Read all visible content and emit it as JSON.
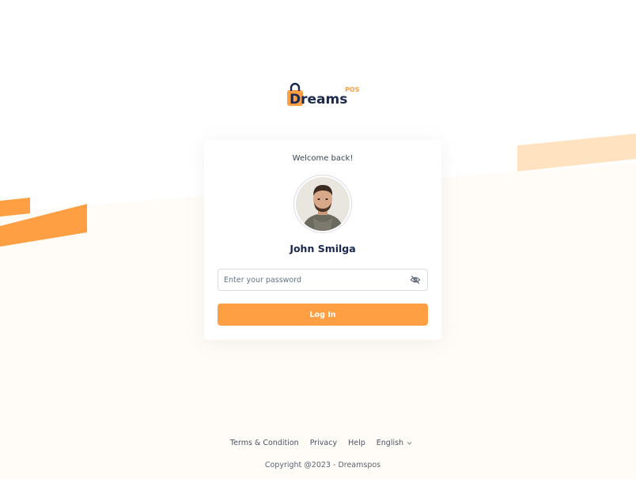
{
  "brand": {
    "logo_text": "Dreams",
    "logo_suffix": "POS",
    "accent_color": "#fe9f43",
    "navy_color": "#1b2850"
  },
  "card": {
    "welcome": "Welcome back!",
    "user_name": "John Smilga",
    "avatar_icon": "user-avatar-photo",
    "password": {
      "placeholder": "Enter your password",
      "value": "",
      "toggle_icon": "eye-off-icon"
    },
    "login_label": "Log In"
  },
  "footer": {
    "links": [
      "Terms & Condition",
      "Privacy",
      "Help"
    ],
    "language": "English",
    "language_icon": "chevron-down-icon",
    "copyright": "Copyright @2023 - Dreamspos"
  }
}
